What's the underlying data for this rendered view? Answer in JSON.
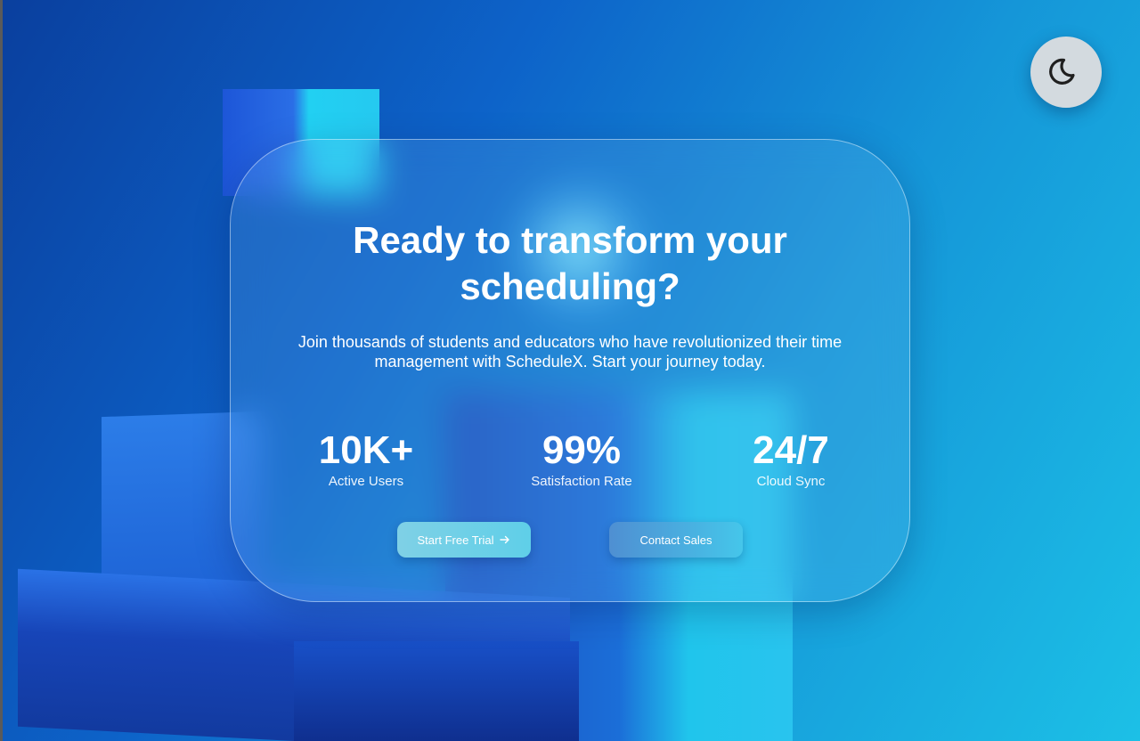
{
  "hero": {
    "title": "Ready to transform your scheduling?",
    "subtitle": "Join thousands of students and educators who have revolutionized their time management with ScheduleX. Start your journey today."
  },
  "stats": [
    {
      "value": "10K+",
      "label": "Active Users"
    },
    {
      "value": "99%",
      "label": "Satisfaction Rate"
    },
    {
      "value": "24/7",
      "label": "Cloud Sync"
    }
  ],
  "buttons": {
    "primary_label": "Start Free Trial",
    "primary_icon": "arrow-right-icon",
    "secondary_label": "Contact Sales"
  },
  "theme_toggle": {
    "icon": "moon-icon"
  },
  "colors": {
    "background_start": "#0a3f9e",
    "background_end": "#1cc0e6",
    "text": "#ffffff",
    "toggle_bg": "#d3dadf"
  }
}
